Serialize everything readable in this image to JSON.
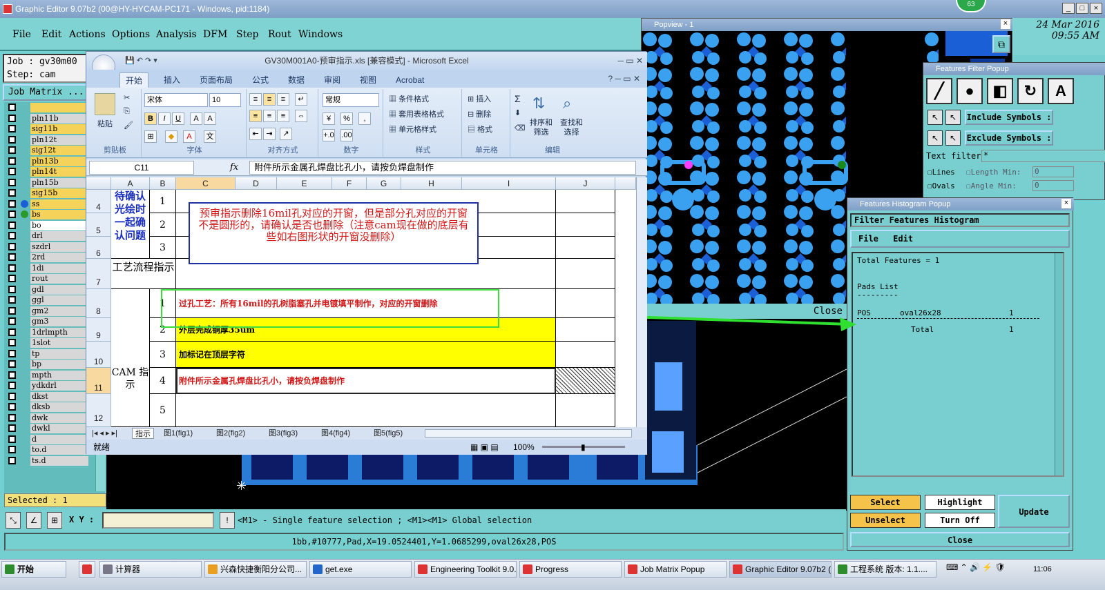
{
  "ge": {
    "title": "Graphic Editor 9.07b2 (00@HY-HYCAM-PC171 - Windows, pid:1184)",
    "menu": [
      "File",
      "Edit",
      "Actions",
      "Options",
      "Analysis",
      "DFM",
      "Step",
      "Rout",
      "Windows"
    ],
    "job_line": "Job : gv30m00",
    "step_line": "Step: cam",
    "job_matrix": "Job Matrix ...",
    "selected": "Selected : 1",
    "xy_label": "X Y :",
    "message": "<M1> - Single feature selection ; <M1><M1> Global selection",
    "status": "1bb,#10777,Pad,X=19.0524401,Y=1.0685299,oval26x28,POS",
    "date": "24 Mar 2016",
    "time": "09:55 AM",
    "badge": "63",
    "layers": [
      {
        "name": "",
        "color": "#f5d25a"
      },
      {
        "name": "pln11b",
        "color": "#d7d7d7"
      },
      {
        "name": "sig11b",
        "color": "#f5d25a"
      },
      {
        "name": "pln12t",
        "color": "#d7d7d7"
      },
      {
        "name": "sig12t",
        "color": "#f5d25a"
      },
      {
        "name": "pln13b",
        "color": "#f5d25a"
      },
      {
        "name": "pln14t",
        "color": "#f5d25a"
      },
      {
        "name": "pln15b",
        "color": "#d7d7d7"
      },
      {
        "name": "sig15b",
        "color": "#f5d25a"
      },
      {
        "name": "ss",
        "color": "#f5d25a"
      },
      {
        "name": "bs",
        "color": "#f5d25a"
      },
      {
        "name": "bo",
        "color": "#ffffff"
      },
      {
        "name": "drl",
        "color": "#d7d7d7"
      },
      {
        "name": "szdrl",
        "color": "#d7d7d7"
      },
      {
        "name": "2rd",
        "color": "#d7d7d7"
      },
      {
        "name": "1di",
        "color": "#d7d7d7"
      },
      {
        "name": "rout",
        "color": "#d7d7d7"
      },
      {
        "name": "gdl",
        "color": "#d7d7d7"
      },
      {
        "name": "ggl",
        "color": "#d7d7d7"
      },
      {
        "name": "gm2",
        "color": "#d7d7d7"
      },
      {
        "name": "gm3",
        "color": "#d7d7d7"
      },
      {
        "name": "1drlmpth",
        "color": "#d7d7d7"
      },
      {
        "name": "1slot",
        "color": "#d7d7d7"
      },
      {
        "name": "tp",
        "color": "#d7d7d7"
      },
      {
        "name": "bp",
        "color": "#d7d7d7"
      },
      {
        "name": "mpth",
        "color": "#d7d7d7"
      },
      {
        "name": "ydkdrl",
        "color": "#d7d7d7"
      },
      {
        "name": "dkst",
        "color": "#d7d7d7"
      },
      {
        "name": "dksb",
        "color": "#d7d7d7"
      },
      {
        "name": "dwk",
        "color": "#d7d7d7"
      },
      {
        "name": "dwkl",
        "color": "#d7d7d7"
      },
      {
        "name": "d",
        "color": "#d7d7d7"
      },
      {
        "name": "to.d",
        "color": "#d7d7d7"
      },
      {
        "name": "ts.d",
        "color": "#d7d7d7"
      }
    ]
  },
  "popview": {
    "title": "Popview - 1",
    "close": "Close"
  },
  "ffp": {
    "title": "Features Filter Popup",
    "include": "Include Symbols :",
    "exclude": "Exclude Symbols :",
    "text_filter": "Text filter",
    "text_filter_value": "*",
    "lines": "Lines",
    "ovals": "Ovals",
    "length": "Length",
    "angle": "Angle",
    "min": "Min:",
    "zero": "0"
  },
  "hist": {
    "title": "Features Histogram Popup",
    "header": "Filter Features Histogram",
    "file": "File",
    "edit": "Edit",
    "total_features": "Total Features = 1",
    "pads_list": "Pads List",
    "sep": "---------",
    "row_pol": "POS",
    "row_sym": "oval26x28",
    "row_count": "1",
    "total_label": "Total",
    "total_count": "1",
    "select": "Select",
    "unselect": "Unselect",
    "highlight": "Highlight",
    "turn_off": "Turn Off",
    "update": "Update",
    "close": "Close"
  },
  "excel": {
    "title": "GV30M001A0-预审指示.xls  [兼容模式] - Microsoft Excel",
    "tabs": [
      "开始",
      "插入",
      "页面布局",
      "公式",
      "数据",
      "审阅",
      "视图",
      "Acrobat"
    ],
    "font": "宋体",
    "size": "10",
    "numfmt": "常规",
    "paste": "粘贴",
    "groups": [
      "剪贴板",
      "字体",
      "对齐方式",
      "数字",
      "样式",
      "单元格",
      "编辑"
    ],
    "style_items": [
      "条件格式",
      "套用表格格式",
      "单元格样式"
    ],
    "cell_items": [
      "插入",
      "删除",
      "格式"
    ],
    "edit_items": [
      "排序和\n筛选",
      "查找和\n选择"
    ],
    "namebox": "C11",
    "fx": "fx",
    "formula": "附件所示金属孔焊盘比孔小，请按负焊盘制作",
    "cols": [
      "A",
      "B",
      "C",
      "D",
      "E",
      "F",
      "G",
      "H",
      "I",
      "J"
    ],
    "rows": [
      "4",
      "5",
      "6",
      "7",
      "8",
      "9",
      "10",
      "11",
      "12"
    ],
    "a_text": "待确认光绘时一起确认问题",
    "b4": "1",
    "b5": "2",
    "b6": "3",
    "a7": "工艺流程指示",
    "a_cam": "CAM 指示",
    "b8": "1",
    "b9": "2",
    "b10": "3",
    "b11": "4",
    "b12": "5",
    "c8": "过孔工艺：所有16mil的孔树脂塞孔并电镀填平制作，对应的开窗删除",
    "c9": "外层完成铜厚35um",
    "c10": "加标记在顶层字符",
    "c11": "附件所示金属孔焊盘比孔小，请按负焊盘制作",
    "note": "预审指示删除16mil孔对应的开窗，但是部分孔对应的开窗不是圆形的，请确认是否也删除（注意cam现在做的底层有些如右图形状的开窗没删除）",
    "sheets": [
      "指示",
      "图1(fig1)",
      "图2(fig2)",
      "图3(fig3)",
      "图4(fig4)",
      "图5(fig5)"
    ],
    "ready": "就绪",
    "zoom": "100%"
  },
  "taskbar": {
    "start": "开始",
    "tasks": [
      "计算器",
      "兴森快捷衡阳分公司...",
      "get.exe",
      "Engineering Toolkit 9.0...",
      "Progress",
      "Job Matrix Popup",
      "Graphic Editor 9.07b2 (...",
      "工程系统  版本: 1.1...."
    ],
    "clock": "11:06"
  }
}
